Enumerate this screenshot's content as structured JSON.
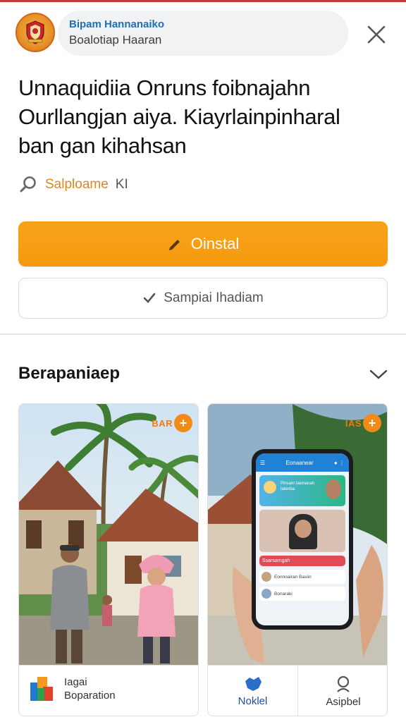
{
  "header": {
    "app_title": "Bipam Hannanaiko",
    "app_subtitle": "Boalotiap Haaran",
    "close_label": "close"
  },
  "headline": {
    "line1": "Unnaquidiia Onruns foibnajahn",
    "line2": "Ourllangjan aiya. Kiayrlainpinharal",
    "line3": "ban gan kihahsan"
  },
  "meta": {
    "label": "Salploame",
    "suffix": "KI"
  },
  "actions": {
    "install_label": "Oinstal",
    "secondary_label": "Sampiai Ihadiam"
  },
  "section": {
    "title": "Berapaniaep"
  },
  "cards": [
    {
      "badge_text": "BAR",
      "footer_line1": "Iagai",
      "footer_line2": "Boparation"
    },
    {
      "badge_text": "IAS",
      "footer_left_label": "Noklel",
      "footer_right_label": "Asipbel",
      "phone": {
        "app_name": "Eonaanear",
        "hero_text": "Pinsam Iaionanah Iatenba",
        "list_heading": "Ssarsamgah",
        "row1": "Eonnoairan Basiin",
        "row2": "Bonaraki"
      }
    }
  ],
  "colors": {
    "accent_orange": "#f59a0e",
    "brand_blue": "#1f6fb3",
    "top_accent": "#c0393b"
  }
}
